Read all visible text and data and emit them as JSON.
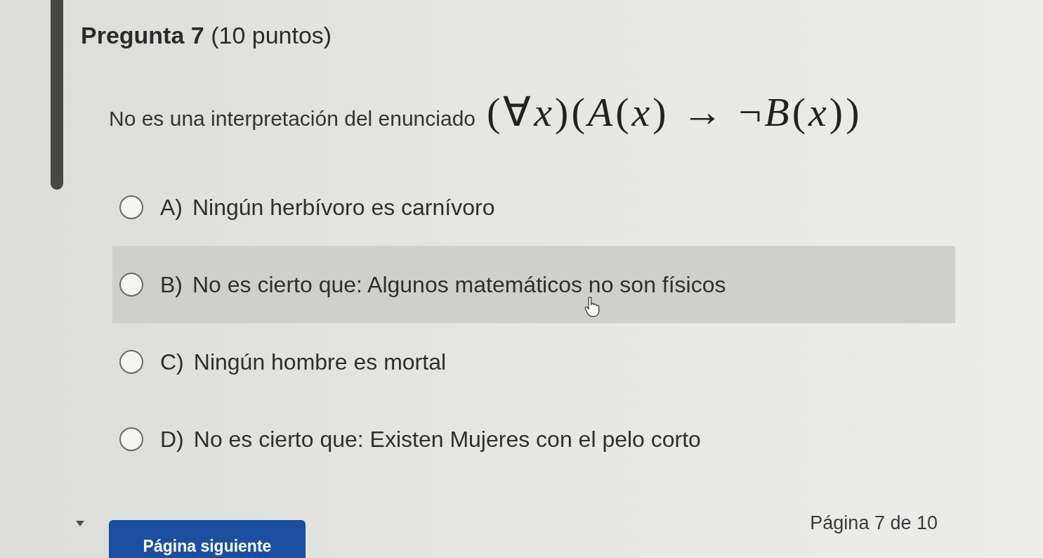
{
  "question": {
    "title": "Pregunta 7",
    "points": "(10 puntos)",
    "prompt": "No es una interpretación del enunciado",
    "formula": "(∀*x*)(*A*(*x*) → ¬*B*(*x*))"
  },
  "options": [
    {
      "letter": "A)",
      "text": "Ningún herbívoro es carnívoro",
      "selected": false,
      "hovered": false
    },
    {
      "letter": "B)",
      "text": "No es cierto que: Algunos matemáticos no son físicos",
      "selected": false,
      "hovered": true
    },
    {
      "letter": "C)",
      "text": "Ningún hombre es mortal",
      "selected": false,
      "hovered": false
    },
    {
      "letter": "D)",
      "text": "No es cierto que: Existen Mujeres con el pelo corto",
      "selected": false,
      "hovered": false
    }
  ],
  "navigation": {
    "next_button": "Página siguiente",
    "page_indicator": "Página 7 de 10"
  }
}
